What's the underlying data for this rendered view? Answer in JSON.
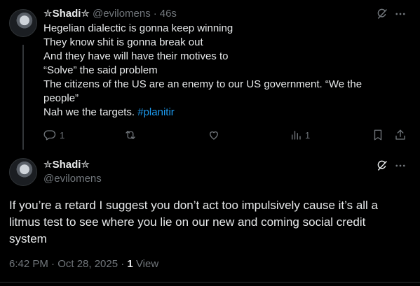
{
  "reply": {
    "display_name": "✮Shadi✮",
    "handle": "@evilomens",
    "separator": "·",
    "time_ago": "46s",
    "lines": [
      "Hegelian dialectic is gonna keep winning",
      "They know shit is gonna break out",
      "And they have will have their motives to",
      "“Solve” the said problem",
      "The citizens of the US are an enemy to our US government. “We the",
      "people”"
    ],
    "last_line_text": "Nah we the targets. ",
    "hashtag": "#planitir",
    "reply_count": "1",
    "view_count": "1"
  },
  "main": {
    "display_name": "✮Shadi✮",
    "handle": "@evilomens",
    "lines": [
      "If you’re a retard I suggest you don’t act too impulsively cause it’s all a",
      "litmus test to see where you lie on our new and coming social credit",
      "system"
    ],
    "timestamp": "6:42 PM · Oct 28, 2025 · ",
    "views_count": "1",
    "views_label": "View"
  },
  "icons": {
    "grok": "grok-icon",
    "more": "more-icon",
    "reply": "reply-icon",
    "retweet": "retweet-icon",
    "like": "like-icon",
    "analytics": "analytics-icon",
    "bookmark": "bookmark-icon",
    "share": "share-icon"
  },
  "colors": {
    "background": "#000000",
    "text": "#e7e9ea",
    "muted": "#71767b",
    "link": "#1d9bf0",
    "divider": "#2f3336"
  }
}
